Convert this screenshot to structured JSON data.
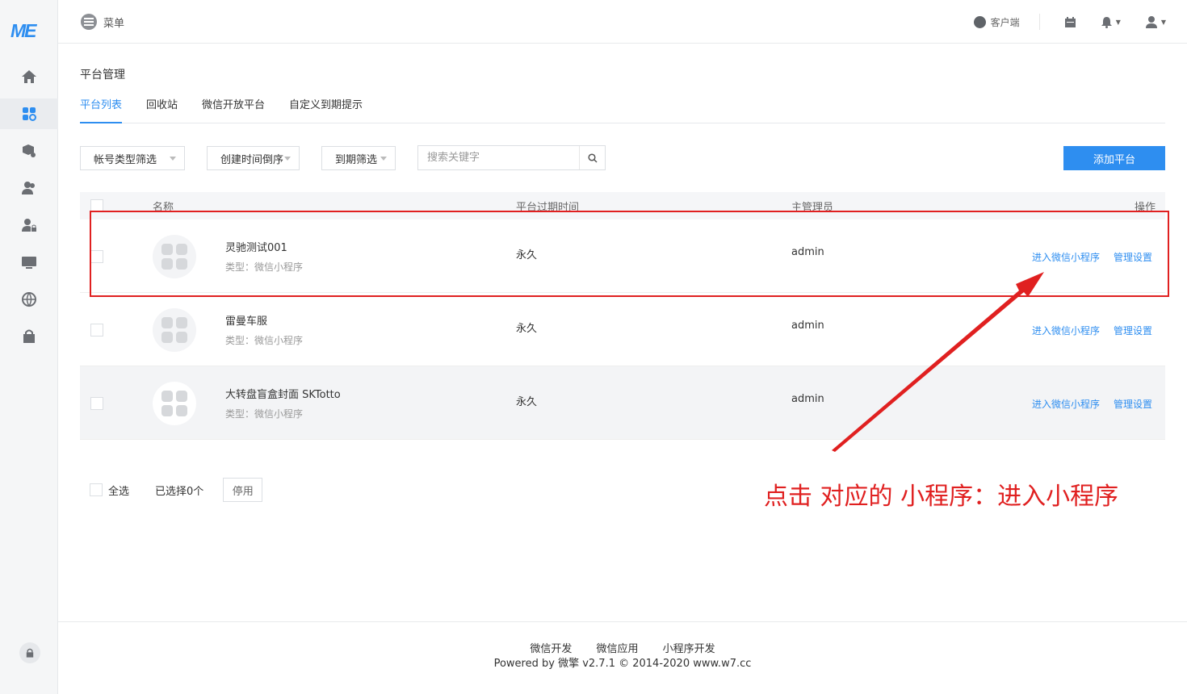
{
  "brand": {
    "logo_text": "ME",
    "accent": "#2e8ef0"
  },
  "topbar": {
    "menu_label": "菜单",
    "client_label": "客户端"
  },
  "page": {
    "title": "平台管理"
  },
  "tabs": [
    {
      "label": "平台列表",
      "active": true
    },
    {
      "label": "回收站",
      "active": false
    },
    {
      "label": "微信开放平台",
      "active": false
    },
    {
      "label": "自定义到期提示",
      "active": false
    }
  ],
  "filters": {
    "account_type": "帐号类型筛选",
    "create_time": "创建时间倒序",
    "expire": "到期筛选",
    "search_placeholder": "搜索关键字",
    "add_button": "添加平台"
  },
  "table": {
    "headers": {
      "name": "名称",
      "expire": "平台过期时间",
      "admin": "主管理员",
      "ops": "操作"
    },
    "rows": [
      {
        "name": "灵驰测试001",
        "type": "类型：微信小程序",
        "expire": "永久",
        "admin": "admin",
        "op_enter": "进入微信小程序",
        "op_manage": "管理设置"
      },
      {
        "name": "雷曼车服",
        "type": "类型：微信小程序",
        "expire": "永久",
        "admin": "admin",
        "op_enter": "进入微信小程序",
        "op_manage": "管理设置"
      },
      {
        "name": "大转盘盲盒封面 SKTotto",
        "type": "类型：微信小程序",
        "expire": "永久",
        "admin": "admin",
        "op_enter": "进入微信小程序",
        "op_manage": "管理设置"
      }
    ]
  },
  "bulk": {
    "select_all": "全选",
    "selected": "已选择0个",
    "disable_button": "停用"
  },
  "annotation": {
    "text": "点击 对应的 小程序：进入小程序",
    "color": "#e02020"
  },
  "footer": {
    "links": [
      "微信开发",
      "微信应用",
      "小程序开发"
    ],
    "copyright": "Powered by 微擎 v2.7.1 © 2014-2020 www.w7.cc"
  },
  "icons": [
    "home-icon",
    "apps-icon",
    "cube-icon",
    "users-icon",
    "user-lock-icon",
    "monitor-icon",
    "globe-icon",
    "bag-icon",
    "lock-icon",
    "menu-icon",
    "client-icon",
    "calendar-icon",
    "bell-icon",
    "user-icon",
    "search-icon"
  ]
}
